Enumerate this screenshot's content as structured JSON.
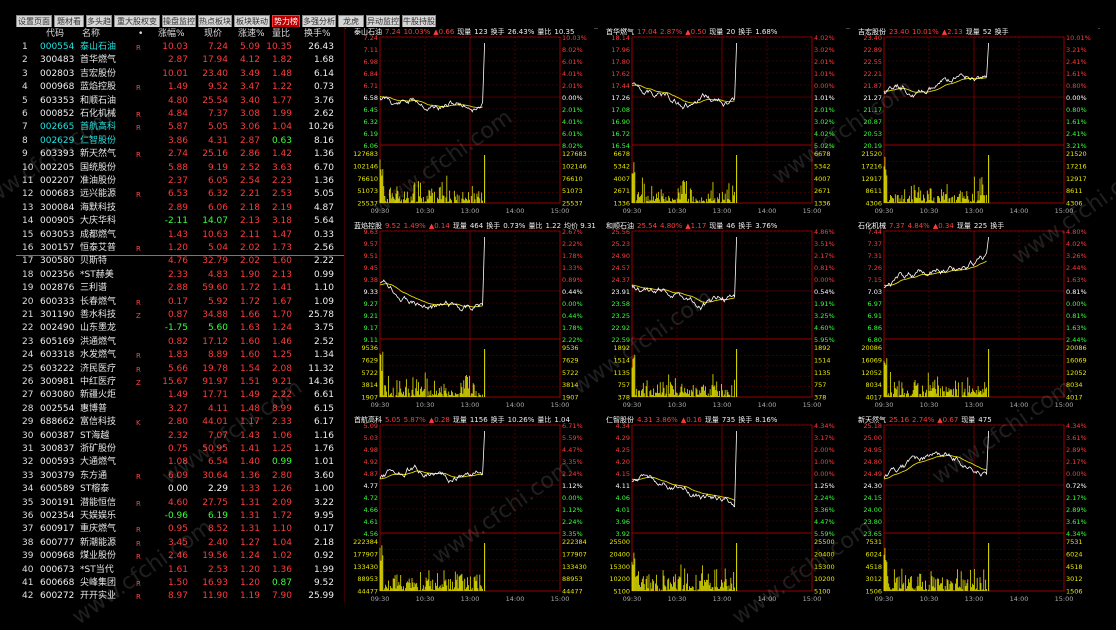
{
  "tabs": [
    "设置页面",
    "题材看盘",
    "多头趋",
    "重大股权变更",
    "操盘监控",
    "热点板块",
    "板块联动",
    "势力榜",
    "多强分析",
    "龙虎",
    "异动监控",
    "牛股持股"
  ],
  "active_tab": 7,
  "list_headers": {
    "code": "代码",
    "name": "名称",
    "dot": "•",
    "chg": "涨幅%",
    "price": "现价",
    "speed": "涨速%",
    "ratio": "量比",
    "turnover": "换手%"
  },
  "stocks": [
    {
      "i": "1",
      "code": "000554",
      "name": "泰山石油",
      "flag": "R",
      "chg": "10.03",
      "price": "7.24",
      "speed": "5.09",
      "ratio": "10.35",
      "turn": "26.43",
      "nc": "cyan"
    },
    {
      "i": "2",
      "code": "300483",
      "name": "首华燃气",
      "flag": "",
      "chg": "2.87",
      "price": "17.94",
      "speed": "4.12",
      "ratio": "1.82",
      "turn": "1.68",
      "nc": "white"
    },
    {
      "i": "3",
      "code": "002803",
      "name": "吉宏股份",
      "flag": "",
      "chg": "10.01",
      "price": "23.40",
      "speed": "3.49",
      "ratio": "1.48",
      "turn": "6.14",
      "nc": "white"
    },
    {
      "i": "4",
      "code": "000968",
      "name": "蓝焰控股",
      "flag": "R",
      "chg": "1.49",
      "price": "9.52",
      "speed": "3.47",
      "ratio": "1.22",
      "turn": "0.73",
      "nc": "white"
    },
    {
      "i": "5",
      "code": "603353",
      "name": "和顺石油",
      "flag": "",
      "chg": "4.80",
      "price": "25.54",
      "speed": "3.40",
      "ratio": "1.77",
      "turn": "3.76",
      "nc": "white"
    },
    {
      "i": "6",
      "code": "000852",
      "name": "石化机械",
      "flag": "R",
      "chg": "4.84",
      "price": "7.37",
      "speed": "3.08",
      "ratio": "1.99",
      "turn": "2.62",
      "nc": "white"
    },
    {
      "i": "7",
      "code": "002665",
      "name": "首航高科",
      "flag": "R",
      "chg": "5.87",
      "price": "5.05",
      "speed": "3.06",
      "ratio": "1.04",
      "turn": "10.26",
      "nc": "cyan"
    },
    {
      "i": "8",
      "code": "002629",
      "name": "仁智股份",
      "flag": "",
      "chg": "3.86",
      "price": "4.31",
      "speed": "2.87",
      "ratio": "0.63",
      "turn": "8.16",
      "nc": "cyan"
    },
    {
      "i": "9",
      "code": "603393",
      "name": "新天然气",
      "flag": "R",
      "chg": "2.74",
      "price": "25.16",
      "speed": "2.86",
      "ratio": "1.42",
      "turn": "1.36",
      "nc": "white"
    },
    {
      "i": "10",
      "code": "002205",
      "name": "国统股份",
      "flag": "",
      "chg": "5.88",
      "price": "9.19",
      "speed": "2.52",
      "ratio": "3.63",
      "turn": "6.70",
      "nc": "white"
    },
    {
      "i": "11",
      "code": "002207",
      "name": "准油股份",
      "flag": "",
      "chg": "2.37",
      "price": "6.05",
      "speed": "2.54",
      "ratio": "2.23",
      "turn": "1.36",
      "nc": "white"
    },
    {
      "i": "12",
      "code": "000683",
      "name": "远兴能源",
      "flag": "R",
      "chg": "6.53",
      "price": "6.32",
      "speed": "2.21",
      "ratio": "2.53",
      "turn": "5.05",
      "nc": "white"
    },
    {
      "i": "13",
      "code": "300084",
      "name": "海默科技",
      "flag": "",
      "chg": "2.89",
      "price": "6.06",
      "speed": "2.18",
      "ratio": "2.19",
      "turn": "4.87",
      "nc": "white"
    },
    {
      "i": "14",
      "code": "000905",
      "name": "大庆华科",
      "flag": "",
      "chg": "-2.11",
      "price": "14.07",
      "speed": "2.13",
      "ratio": "3.18",
      "turn": "5.64",
      "nc": "white"
    },
    {
      "i": "15",
      "code": "603053",
      "name": "成都燃气",
      "flag": "",
      "chg": "1.43",
      "price": "10.63",
      "speed": "2.11",
      "ratio": "1.47",
      "turn": "0.33",
      "nc": "white"
    },
    {
      "i": "16",
      "code": "300157",
      "name": "恒泰艾普",
      "flag": "R",
      "chg": "1.20",
      "price": "5.04",
      "speed": "2.02",
      "ratio": "1.73",
      "turn": "2.56",
      "nc": "white"
    },
    {
      "i": "17",
      "code": "300580",
      "name": "贝斯特",
      "flag": "",
      "chg": "4.76",
      "price": "32.79",
      "speed": "2.02",
      "ratio": "1.60",
      "turn": "2.22",
      "nc": "white"
    },
    {
      "i": "18",
      "code": "002356",
      "name": "*ST赫美",
      "flag": "",
      "chg": "2.33",
      "price": "4.83",
      "speed": "1.90",
      "ratio": "2.13",
      "turn": "0.99",
      "nc": "white"
    },
    {
      "i": "19",
      "code": "002876",
      "name": "三利谱",
      "flag": "",
      "chg": "2.88",
      "price": "59.60",
      "speed": "1.72",
      "ratio": "1.41",
      "turn": "1.10",
      "nc": "white"
    },
    {
      "i": "20",
      "code": "600333",
      "name": "长春燃气",
      "flag": "R",
      "chg": "0.17",
      "price": "5.92",
      "speed": "1.72",
      "ratio": "1.67",
      "turn": "1.09",
      "nc": "white"
    },
    {
      "i": "21",
      "code": "301190",
      "name": "善水科技",
      "flag": "Z",
      "chg": "0.87",
      "price": "34.88",
      "speed": "1.66",
      "ratio": "1.70",
      "turn": "25.78",
      "nc": "white"
    },
    {
      "i": "22",
      "code": "002490",
      "name": "山东墨龙",
      "flag": "",
      "chg": "-1.75",
      "price": "5.60",
      "speed": "1.63",
      "ratio": "1.24",
      "turn": "3.75",
      "nc": "white"
    },
    {
      "i": "23",
      "code": "605169",
      "name": "洪通燃气",
      "flag": "",
      "chg": "0.82",
      "price": "17.12",
      "speed": "1.60",
      "ratio": "1.46",
      "turn": "2.52",
      "nc": "white"
    },
    {
      "i": "24",
      "code": "603318",
      "name": "水发燃气",
      "flag": "R",
      "chg": "1.83",
      "price": "8.89",
      "speed": "1.60",
      "ratio": "1.25",
      "turn": "1.34",
      "nc": "white"
    },
    {
      "i": "25",
      "code": "603222",
      "name": "济民医疗",
      "flag": "R",
      "chg": "5.66",
      "price": "19.78",
      "speed": "1.54",
      "ratio": "2.08",
      "turn": "11.32",
      "nc": "white"
    },
    {
      "i": "26",
      "code": "300981",
      "name": "中红医疗",
      "flag": "Z",
      "chg": "15.67",
      "price": "91.97",
      "speed": "1.51",
      "ratio": "9.21",
      "turn": "14.36",
      "nc": "white"
    },
    {
      "i": "27",
      "code": "603080",
      "name": "新疆火炬",
      "flag": "",
      "chg": "1.49",
      "price": "17.71",
      "speed": "1.49",
      "ratio": "2.22",
      "turn": "6.61",
      "nc": "white"
    },
    {
      "i": "28",
      "code": "002554",
      "name": "惠博普",
      "flag": "",
      "chg": "3.27",
      "price": "4.11",
      "speed": "1.48",
      "ratio": "8.99",
      "turn": "6.15",
      "nc": "white"
    },
    {
      "i": "29",
      "code": "688662",
      "name": "富信科技",
      "flag": "K",
      "chg": "2.80",
      "price": "44.01",
      "speed": "1.17",
      "ratio": "2.33",
      "turn": "6.17",
      "nc": "white"
    },
    {
      "i": "30",
      "code": "600387",
      "name": "ST海越",
      "flag": "",
      "chg": "2.32",
      "price": "7.07",
      "speed": "1.43",
      "ratio": "1.06",
      "turn": "1.16",
      "nc": "white"
    },
    {
      "i": "31",
      "code": "300837",
      "name": "浙矿股份",
      "flag": "",
      "chg": "0.75",
      "price": "50.95",
      "speed": "1.41",
      "ratio": "1.25",
      "turn": "1.76",
      "nc": "white"
    },
    {
      "i": "32",
      "code": "000593",
      "name": "大通燃气",
      "flag": "",
      "chg": "1.08",
      "price": "6.54",
      "speed": "1.40",
      "ratio": "0.99",
      "turn": "1.01",
      "nc": "white"
    },
    {
      "i": "33",
      "code": "300379",
      "name": "东方通",
      "flag": "R",
      "chg": "6.09",
      "price": "30.64",
      "speed": "1.36",
      "ratio": "2.80",
      "turn": "3.60",
      "nc": "white"
    },
    {
      "i": "34",
      "code": "600589",
      "name": "ST榕泰",
      "flag": "",
      "chg": "0.00",
      "price": "2.29",
      "speed": "1.33",
      "ratio": "1.26",
      "turn": "1.00",
      "nc": "white"
    },
    {
      "i": "35",
      "code": "300191",
      "name": "潜能恒信",
      "flag": "R",
      "chg": "4.60",
      "price": "27.75",
      "speed": "1.31",
      "ratio": "2.09",
      "turn": "3.22",
      "nc": "white"
    },
    {
      "i": "36",
      "code": "002354",
      "name": "天娱娱乐",
      "flag": "",
      "chg": "-0.96",
      "price": "6.19",
      "speed": "1.31",
      "ratio": "1.72",
      "turn": "9.95",
      "nc": "white"
    },
    {
      "i": "37",
      "code": "600917",
      "name": "重庆燃气",
      "flag": "R",
      "chg": "0.95",
      "price": "8.52",
      "speed": "1.31",
      "ratio": "1.10",
      "turn": "0.17",
      "nc": "white"
    },
    {
      "i": "38",
      "code": "600777",
      "name": "新潮能源",
      "flag": "R",
      "chg": "3.45",
      "price": "2.40",
      "speed": "1.27",
      "ratio": "1.04",
      "turn": "2.18",
      "nc": "white"
    },
    {
      "i": "39",
      "code": "000968",
      "name": "煤业股份",
      "flag": "R",
      "chg": "2.46",
      "price": "19.56",
      "speed": "1.24",
      "ratio": "1.02",
      "turn": "0.92",
      "nc": "white"
    },
    {
      "i": "40",
      "code": "000673",
      "name": "*ST当代",
      "flag": "",
      "chg": "1.61",
      "price": "2.53",
      "speed": "1.20",
      "ratio": "1.36",
      "turn": "1.99",
      "nc": "white"
    },
    {
      "i": "41",
      "code": "600668",
      "name": "尖峰集团",
      "flag": "R",
      "chg": "1.50",
      "price": "16.93",
      "speed": "1.20",
      "ratio": "0.87",
      "turn": "9.52",
      "nc": "white"
    },
    {
      "i": "42",
      "code": "600272",
      "name": "开开实业",
      "flag": "R",
      "chg": "8.97",
      "price": "11.90",
      "speed": "1.19",
      "ratio": "7.90",
      "turn": "25.99",
      "nc": "white"
    }
  ],
  "panels": [
    {
      "name": "泰山石油",
      "price": "7.24",
      "pct": "10.03%",
      "arrow": "▲0.66",
      "vol_label": "现量",
      "vol": "123",
      "turn_label": "换手",
      "turn": "26.43%",
      "ratio_label": "量比",
      "ratio": "10.35",
      "extra": "",
      "left_prices": [
        "7.24",
        "7.11",
        "6.98",
        "6.84",
        "6.71",
        "6.58",
        "6.45",
        "6.32",
        "6.19",
        "6.06"
      ],
      "right_pcts": [
        "10.03%",
        "8.02%",
        "6.01%",
        "4.01%",
        "2.01%",
        "0.00%",
        "2.01%",
        "4.01%",
        "6.01%",
        "8.02%"
      ],
      "vols": [
        "127683",
        "102146",
        "76610",
        "51073",
        "25537"
      ],
      "pattern": "spike",
      "base": 0.55,
      "trend": 0.6
    },
    {
      "name": "首华燃气",
      "price": "17.04",
      "pct": "2.87%",
      "arrow": "▲0.50",
      "vol_label": "现量",
      "vol": "20",
      "turn_label": "换手",
      "turn": "1.68%",
      "ratio_label": "",
      "ratio": "",
      "extra": "",
      "left_prices": [
        "18.14",
        "17.96",
        "17.80",
        "17.62",
        "17.44",
        "17.26",
        "17.08",
        "16.90",
        "16.72",
        "16.54"
      ],
      "right_pcts": [
        "4.02%",
        "3.02%",
        "2.01%",
        "1.01%",
        "0.00%",
        "1.01%",
        "2.01%",
        "3.02%",
        "4.02%",
        "5.02%"
      ],
      "vols": [
        "6678",
        "5342",
        "4007",
        "2671",
        "1336"
      ],
      "pattern": "drift_down_spike",
      "base": 0.45,
      "trend": 0.55
    },
    {
      "name": "吉宏股份",
      "price": "23.40",
      "pct": "10.01%",
      "arrow": "▲2.13",
      "vol_label": "现量",
      "vol": "52",
      "turn_label": "换手",
      "turn": "",
      "ratio_label": "",
      "ratio": "",
      "extra": "",
      "left_prices": [
        "23.40",
        "22.89",
        "22.55",
        "22.21",
        "21.87",
        "21.27",
        "21.17",
        "20.87",
        "20.53",
        "20.19"
      ],
      "right_pcts": [
        "10.01%",
        "3.21%",
        "2.41%",
        "1.61%",
        "0.80%",
        "0.00%",
        "0.80%",
        "1.61%",
        "2.41%",
        "3.21%"
      ],
      "vols": [
        "21520",
        "17216",
        "12917",
        "8611",
        "4306"
      ],
      "pattern": "rise",
      "base": 0.5,
      "trend": 0.5
    },
    {
      "name": "蓝焰控股",
      "price": "9.52",
      "pct": "1.49%",
      "arrow": "▲0.14",
      "vol_label": "现量",
      "vol": "464",
      "turn_label": "换手",
      "turn": "0.73%",
      "ratio_label": "量比",
      "ratio": "1.22",
      "extra": "均价 9.31",
      "left_prices": [
        "9.63",
        "9.57",
        "9.51",
        "9.45",
        "9.38",
        "9.33",
        "9.27",
        "9.21",
        "9.17",
        "9.11"
      ],
      "right_pcts": [
        "2.67%",
        "2.22%",
        "1.78%",
        "1.33%",
        "0.89%",
        "0.44%",
        "0.00%",
        "0.44%",
        "1.78%",
        "2.22%"
      ],
      "vols": [
        "9536",
        "7629",
        "5722",
        "3814",
        "1907"
      ],
      "pattern": "dip_spike",
      "base": 0.5,
      "trend": 0.55
    },
    {
      "name": "和顺石油",
      "price": "25.54",
      "pct": "4.80%",
      "arrow": "▲1.17",
      "vol_label": "现量",
      "vol": "46",
      "turn_label": "换手",
      "turn": "3.76%",
      "ratio_label": "",
      "ratio": "",
      "extra": "",
      "left_prices": [
        "25.56",
        "25.23",
        "24.90",
        "24.57",
        "24.37",
        "23.91",
        "23.58",
        "23.25",
        "22.92",
        "22.59"
      ],
      "right_pcts": [
        "4.86%",
        "3.51%",
        "2.17%",
        "0.81%",
        "0.00%",
        "0.54%",
        "1.91%",
        "3.25%",
        "4.60%",
        "5.95%"
      ],
      "vols": [
        "1892",
        "1514",
        "1135",
        "757",
        "378"
      ],
      "pattern": "rise",
      "base": 0.5,
      "trend": 0.55
    },
    {
      "name": "石化机械",
      "price": "7.37",
      "pct": "4.84%",
      "arrow": "▲0.34",
      "vol_label": "现量",
      "vol": "225",
      "turn_label": "换手",
      "turn": "",
      "ratio_label": "",
      "ratio": "",
      "extra": "",
      "left_prices": [
        "7.44",
        "7.37",
        "7.31",
        "7.26",
        "7.15",
        "7.03",
        "6.97",
        "6.91",
        "6.86",
        "6.80"
      ],
      "right_pcts": [
        "4.80%",
        "4.02%",
        "3.26%",
        "2.44%",
        "1.63%",
        "0.81%",
        "0.00%",
        "0.81%",
        "1.63%",
        "2.44%"
      ],
      "vols": [
        "20086",
        "16069",
        "12052",
        "8034",
        "4017"
      ],
      "pattern": "rise",
      "base": 0.5,
      "trend": 0.55
    },
    {
      "name": "首航高科",
      "price": "5.05",
      "pct": "5.87%",
      "arrow": "▲0.28",
      "vol_label": "现量",
      "vol": "1156",
      "turn_label": "换手",
      "turn": "10.26%",
      "ratio_label": "量比",
      "ratio": "1.04",
      "extra": "",
      "left_prices": [
        "5.09",
        "5.03",
        "4.98",
        "4.92",
        "4.87",
        "4.77",
        "4.72",
        "4.66",
        "4.61",
        "4.56"
      ],
      "right_pcts": [
        "6.71%",
        "5.59%",
        "4.47%",
        "3.35%",
        "2.24%",
        "1.12%",
        "0.00%",
        "1.12%",
        "2.24%",
        "3.35%"
      ],
      "vols": [
        "222384",
        "177907",
        "133430",
        "88953",
        "44477"
      ],
      "pattern": "jump",
      "base": 0.5,
      "trend": 0.55
    },
    {
      "name": "仁智股份",
      "price": "4.31",
      "pct": "3.86%",
      "arrow": "▲0.16",
      "vol_label": "现量",
      "vol": "735",
      "turn_label": "换手",
      "turn": "8.16%",
      "ratio_label": "",
      "ratio": "",
      "extra": "",
      "left_prices": [
        "4.34",
        "4.29",
        "4.25",
        "4.20",
        "4.15",
        "4.11",
        "4.06",
        "4.01",
        "3.96",
        "3.92"
      ],
      "right_pcts": [
        "4.34%",
        "3.17%",
        "2.00%",
        "1.00%",
        "0.00%",
        "1.25%",
        "2.24%",
        "3.36%",
        "4.47%",
        "5.59%"
      ],
      "vols": [
        "25500",
        "20400",
        "15300",
        "10200",
        "5100"
      ],
      "pattern": "drift_down_spike",
      "base": 0.5,
      "trend": 0.55
    },
    {
      "name": "新天然气",
      "price": "25.16",
      "pct": "2.74%",
      "arrow": "▲0.67",
      "vol_label": "现量",
      "vol": "475",
      "turn_label": "",
      "turn": "",
      "ratio_label": "",
      "ratio": "",
      "extra": "",
      "left_prices": [
        "25.18",
        "25.00",
        "24.95",
        "24.80",
        "24.49",
        "24.30",
        "24.15",
        "24.00",
        "23.80",
        "23.65"
      ],
      "right_pcts": [
        "4.34%",
        "3.61%",
        "2.89%",
        "2.17%",
        "0.00%",
        "0.72%",
        "2.17%",
        "2.89%",
        "3.61%",
        "4.34%"
      ],
      "vols": [
        "7531",
        "6024",
        "4518",
        "3012",
        "1506"
      ],
      "pattern": "rise",
      "base": 0.5,
      "trend": 0.55
    }
  ],
  "time_labels": [
    "09:30",
    "10:30",
    "13:00",
    "14:00",
    "15:00"
  ],
  "watermark": "www.cfchi.com"
}
